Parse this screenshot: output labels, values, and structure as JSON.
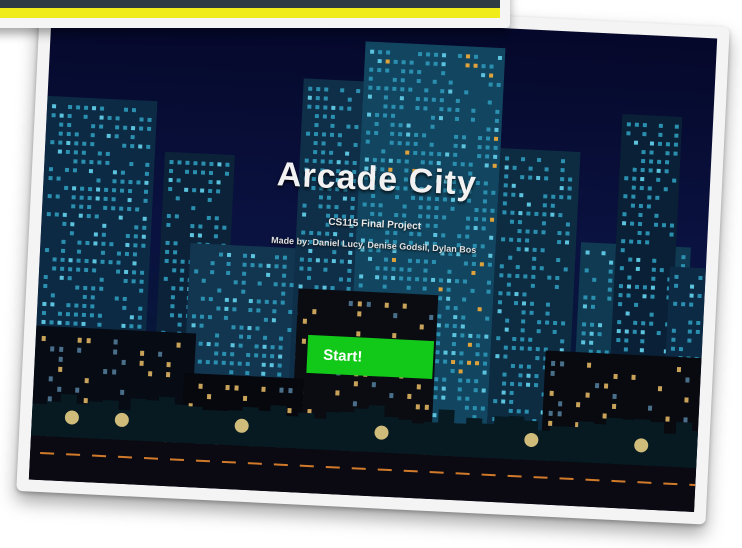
{
  "game": {
    "title": "Arcade City",
    "subtitle": "CS115 Final Project",
    "credits": "Made by: Daniel Lucy, Denise Godsil, Dylan Bos",
    "start_label": "Start!"
  },
  "colors": {
    "sky_top": "#05082a",
    "building": "#0f3a55",
    "window_lit": "#3fa7c4",
    "window_warm": "#e0a23a",
    "start_button": "#12c91a",
    "top_card_bar": "#f0ec1a"
  }
}
